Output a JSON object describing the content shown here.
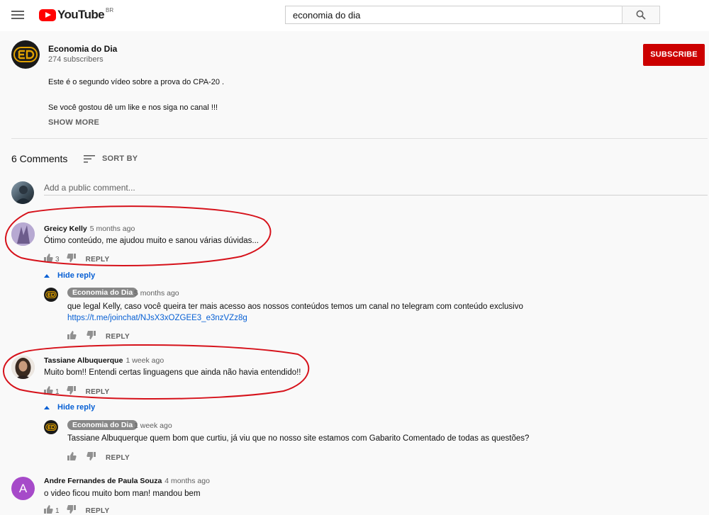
{
  "header": {
    "logo_text": "YouTube",
    "country": "BR",
    "search_value": "economia do dia"
  },
  "channel": {
    "name": "Economia do Dia",
    "subscribers": "274 subscribers",
    "subscribe_label": "SUBSCRIBE",
    "description": [
      "Este é o segundo vídeo sobre a prova do CPA-20 .",
      "Se você gostou dê um like e nos siga no canal !!!"
    ],
    "show_more": "SHOW MORE"
  },
  "comments_section": {
    "count_label": "6 Comments",
    "sort_label": "SORT BY",
    "add_placeholder": "Add a public comment..."
  },
  "comments": [
    {
      "author": "Greicy Kelly",
      "time": "5 months ago",
      "text": "Ótimo conteúdo, me ajudou muito e sanou várias dúvidas...",
      "likes": "3",
      "reply_label": "REPLY",
      "hide_reply": "Hide reply",
      "reply": {
        "author": "Economia do Dia",
        "time": "5 months ago",
        "text": "que legal Kelly, caso você queira ter mais acesso aos nossos conteúdos temos um canal no telegram com conteúdo exclusivo",
        "link": "https://t.me/joinchat/NJsX3xOZGEE3_e3nzVZz8g",
        "reply_label": "REPLY"
      }
    },
    {
      "author": "Tassiane Albuquerque",
      "time": "1 week ago",
      "text": "Muito bom!! Entendi certas linguagens que ainda não havia entendido!!",
      "likes": "1",
      "reply_label": "REPLY",
      "hide_reply": "Hide reply",
      "reply": {
        "author": "Economia do Dia",
        "time": "1 week ago",
        "text": "Tassiane Albuquerque quem bom que curtiu, já viu que no nosso site estamos com Gabarito Comentado de todas as questões?",
        "reply_label": "REPLY"
      }
    },
    {
      "author": "Andre Fernandes de Paula Souza",
      "time": "4 months ago",
      "avatar_letter": "A",
      "text": "o video ficou muito bom man! mandou bem",
      "likes": "1",
      "reply_label": "REPLY"
    }
  ],
  "colors": {
    "subscribe": "#cc0000",
    "link": "#065fd4",
    "annotation": "#d6121b",
    "avatar_andre": "#a64ac9"
  }
}
